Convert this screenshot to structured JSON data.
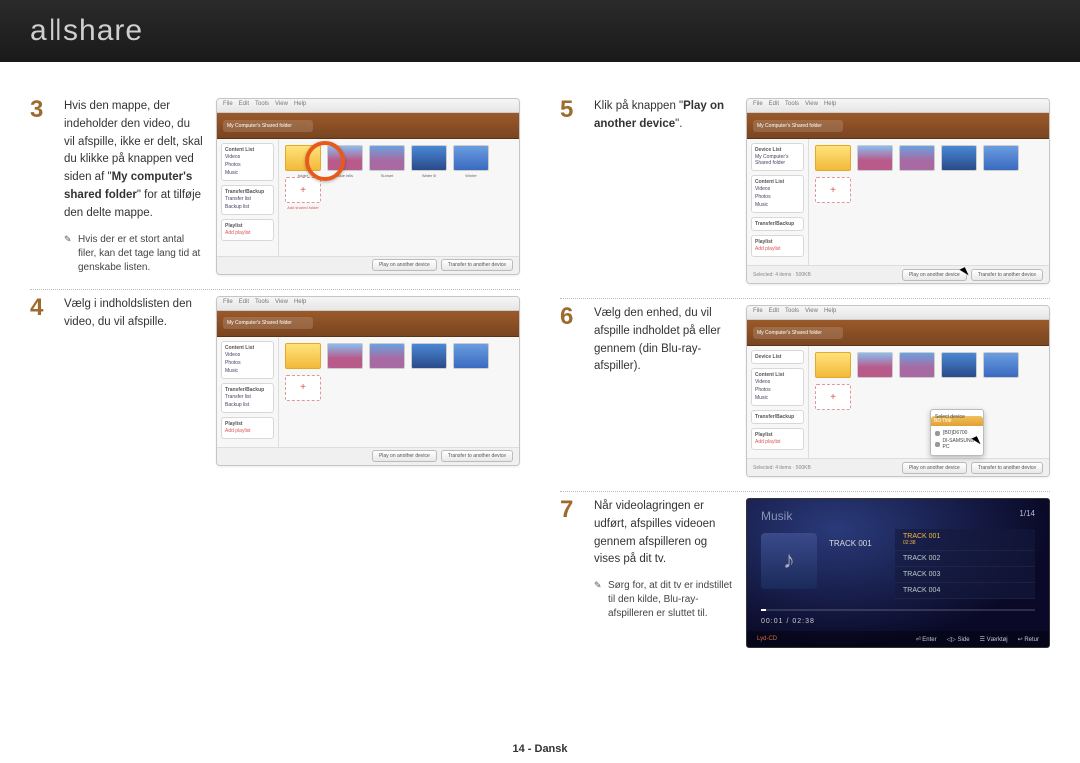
{
  "brand": "allshare",
  "footer": "14 - Dansk",
  "steps": {
    "3": {
      "num": "3",
      "text_pre": "Hvis den mappe, der indeholder den video, du vil afspille, ikke er delt, skal du klikke på knappen ved siden af \"",
      "text_bold": "My computer's shared folder",
      "text_post": "\" for at tilføje den delte mappe.",
      "note": "Hvis der er et stort antal filer, kan det tage lang tid at genskabe listen."
    },
    "4": {
      "num": "4",
      "text": "Vælg i indholdslisten den video, du vil afspille."
    },
    "5": {
      "num": "5",
      "text_pre": "Klik på knappen \"",
      "text_bold": "Play on another device",
      "text_post": "\"."
    },
    "6": {
      "num": "6",
      "text": "Vælg den enhed, du vil afspille indholdet på eller gennem (din Blu-ray-afspiller)."
    },
    "7": {
      "num": "7",
      "text": "Når videolagringen er udført, afspilles videoen gennem afspilleren og vises på dit tv.",
      "note": "Sørg for, at dit tv er indstillet til den kilde, Blu-ray-afspilleren er sluttet til."
    }
  },
  "shot": {
    "menus": [
      "File",
      "Edit",
      "Tools",
      "View",
      "Help"
    ],
    "breadcrumb": "My Computer's Shared folder",
    "side_header1": "Device List",
    "side_header2": "Content List",
    "side_items": [
      "Videos",
      "Photos",
      "Music"
    ],
    "side_header3": "Transfer/Backup",
    "side_t_items": [
      "Transfer list",
      "Backup list"
    ],
    "side_header4": "Playlist",
    "side_playlist_item": "Add playlist",
    "thumb_labels": [
      "folder",
      "Blue hills",
      "Sunset",
      "Water lil",
      "Winter"
    ],
    "add_label": "Add shared folder",
    "footer_left": "Selected: 4 items · 500KB",
    "footer_left_simple": "Selected",
    "btn_play": "Play on another device",
    "btn_transfer": "Transfer to another device",
    "popup_header": "BD Title",
    "popup_items": [
      "[BD]D6700",
      "DI-SAMSUNG-PC"
    ]
  },
  "tv": {
    "title": "Musik",
    "count": "1/14",
    "current_track": "TRACK 001",
    "tracks": [
      "TRACK 001",
      "TRACK 002",
      "TRACK 003",
      "TRACK 004"
    ],
    "selected_duration": "02:38",
    "time": "00:01 / 02:38",
    "source_label": "Lyd-CD",
    "bottom_items": [
      "Enter",
      "Side",
      "Værktøj",
      "Retur"
    ],
    "bottom_icons": [
      "⏎",
      "◁▷",
      "☰",
      "↩"
    ]
  }
}
